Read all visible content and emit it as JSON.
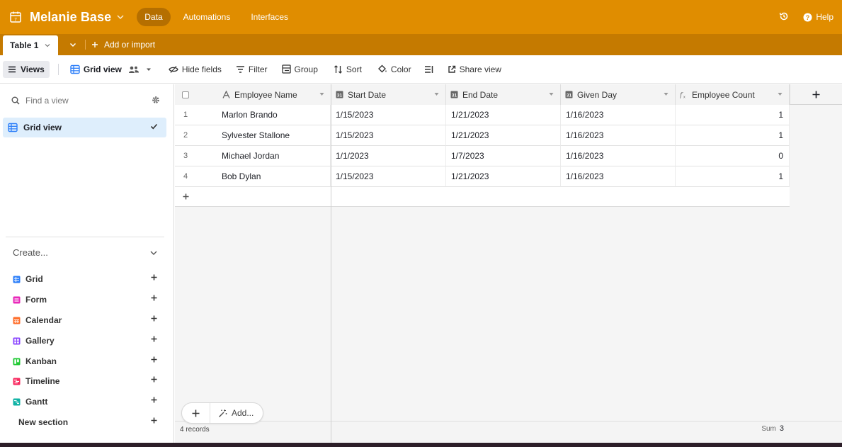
{
  "header": {
    "base_name": "Melanie Base",
    "nav": [
      {
        "label": "Data",
        "active": true
      },
      {
        "label": "Automations"
      },
      {
        "label": "Interfaces"
      }
    ],
    "help_label": "Help",
    "brand_color": "#e08d00"
  },
  "tabs": {
    "active_table": "Table 1",
    "add_import_label": "Add or import"
  },
  "toolbar": {
    "views_label": "Views",
    "view_name": "Grid view",
    "hide_fields": "Hide fields",
    "filter": "Filter",
    "group": "Group",
    "sort": "Sort",
    "color": "Color",
    "share_view": "Share view"
  },
  "sidebar": {
    "find_placeholder": "Find a view",
    "active_view": "Grid view",
    "create_label": "Create...",
    "create_items": [
      {
        "label": "Grid",
        "color": "#2d7ff9"
      },
      {
        "label": "Form",
        "color": "#e929ba"
      },
      {
        "label": "Calendar",
        "color": "#ff6f2c"
      },
      {
        "label": "Gallery",
        "color": "#8b46ff"
      },
      {
        "label": "Kanban",
        "color": "#20c933"
      },
      {
        "label": "Timeline",
        "color": "#f82b60"
      },
      {
        "label": "Gantt",
        "color": "#20d9d2"
      }
    ],
    "new_section_label": "New section"
  },
  "grid": {
    "columns": [
      "Employee Name",
      "Start Date",
      "End Date",
      "Given Day",
      "Employee Count"
    ],
    "rows": [
      {
        "num": "1",
        "name": "Marlon Brando",
        "start": "1/15/2023",
        "end": "1/21/2023",
        "given": "1/16/2023",
        "count": "1"
      },
      {
        "num": "2",
        "name": "Sylvester Stallone",
        "start": "1/15/2023",
        "end": "1/21/2023",
        "given": "1/16/2023",
        "count": "1"
      },
      {
        "num": "3",
        "name": "Michael Jordan",
        "start": "1/1/2023",
        "end": "1/7/2023",
        "given": "1/16/2023",
        "count": "0"
      },
      {
        "num": "4",
        "name": "Bob Dylan",
        "start": "1/15/2023",
        "end": "1/21/2023",
        "given": "1/16/2023",
        "count": "1"
      }
    ],
    "records_label": "4 records",
    "sum_label": "Sum",
    "sum_value": "3",
    "add_label": "Add..."
  }
}
